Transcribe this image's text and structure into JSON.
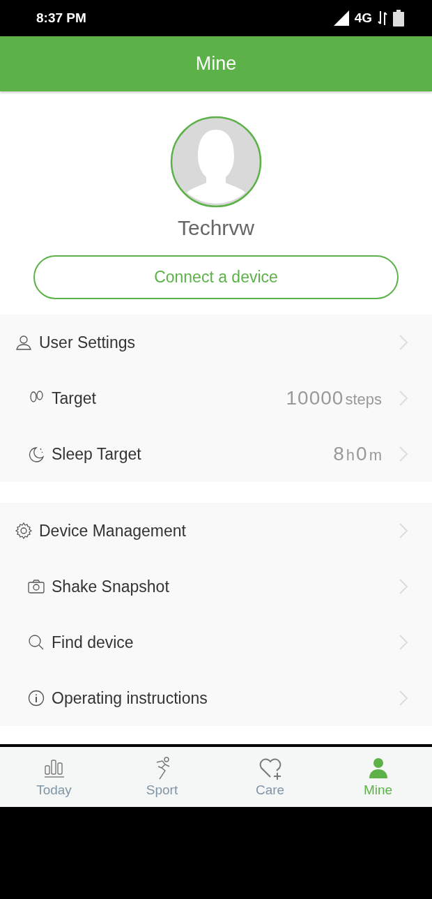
{
  "status_bar": {
    "time": "8:37 PM",
    "network": "4G"
  },
  "header": {
    "title": "Mine"
  },
  "profile": {
    "name": "Techrvw",
    "connect_button": "Connect a device"
  },
  "groups": [
    {
      "items": [
        {
          "label": "User Settings"
        },
        {
          "label": "Target",
          "value": [
            {
              "kind": "number",
              "text": "10000"
            },
            {
              "kind": "unit",
              "text": "steps"
            }
          ]
        },
        {
          "label": "Sleep Target",
          "value": [
            {
              "kind": "number",
              "text": "8"
            },
            {
              "kind": "unit",
              "text": "h"
            },
            {
              "kind": "number",
              "text": "0"
            },
            {
              "kind": "unit",
              "text": "m"
            }
          ]
        }
      ]
    },
    {
      "items": [
        {
          "label": "Device Management"
        },
        {
          "label": "Shake Snapshot"
        },
        {
          "label": "Find device"
        },
        {
          "label": "Operating instructions"
        }
      ]
    }
  ],
  "tabs": [
    {
      "label": "Today",
      "selected": false
    },
    {
      "label": "Sport",
      "selected": false
    },
    {
      "label": "Care",
      "selected": false
    },
    {
      "label": "Mine",
      "selected": true
    }
  ]
}
